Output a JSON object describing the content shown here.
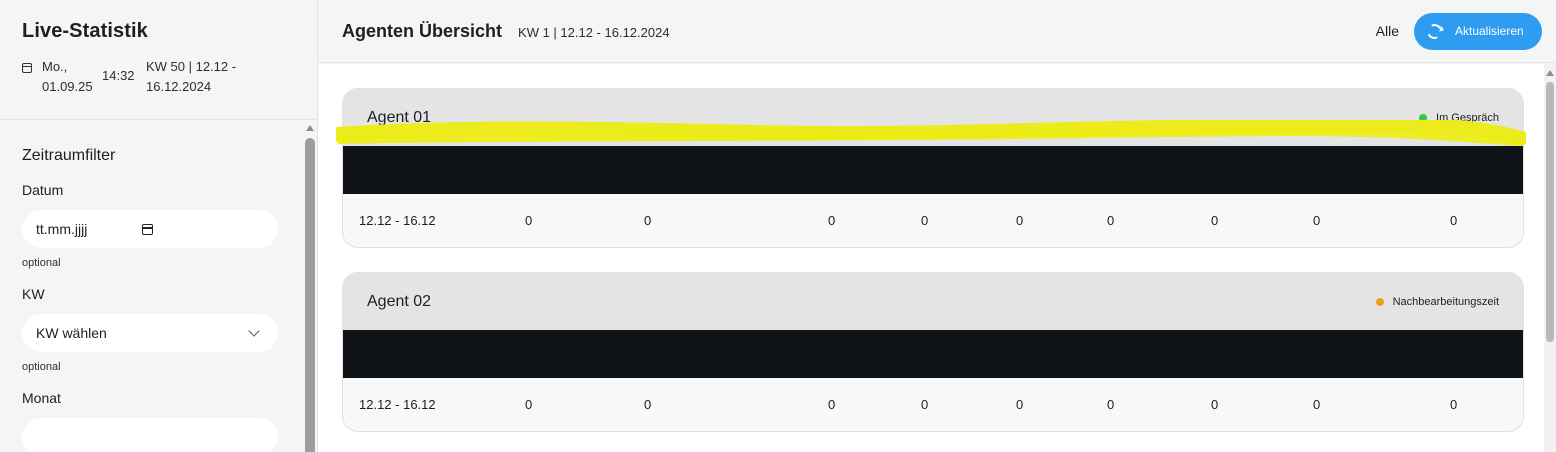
{
  "sidebar": {
    "title": "Live-Statistik",
    "date": "Mo., 01.09.25",
    "time": "14:32",
    "week_range": "KW 50 | 12.12 - 16.12.2024",
    "filter_title": "Zeitraumfilter",
    "fields": {
      "datum_label": "Datum",
      "datum_placeholder": "tt.mm.jjjj",
      "datum_hint": "optional",
      "kw_label": "KW",
      "kw_value": "KW wählen",
      "kw_hint": "optional",
      "monat_label": "Monat"
    }
  },
  "header": {
    "title": "Agenten Übersicht",
    "subtitle": "KW 1 | 12.12 - 16.12.2024",
    "filter_label": "Alle",
    "refresh_label": "Aktualisieren",
    "accent_color": "#2e9cf0"
  },
  "agents": [
    {
      "name": "Agent 01",
      "status": "Im Gespräch",
      "status_color": "#2ecc40",
      "row": {
        "period": "12.12 - 16.12",
        "values": [
          "0",
          "0",
          "0",
          "0",
          "0",
          "0",
          "0",
          "0",
          "0"
        ]
      }
    },
    {
      "name": "Agent 02",
      "status": "Nachbearbeitungszeit",
      "status_color": "#e8a317",
      "row": {
        "period": "12.12 - 16.12",
        "values": [
          "0",
          "0",
          "0",
          "0",
          "0",
          "0",
          "0",
          "0",
          "0"
        ]
      }
    }
  ],
  "annotation_color": "#ecec12"
}
